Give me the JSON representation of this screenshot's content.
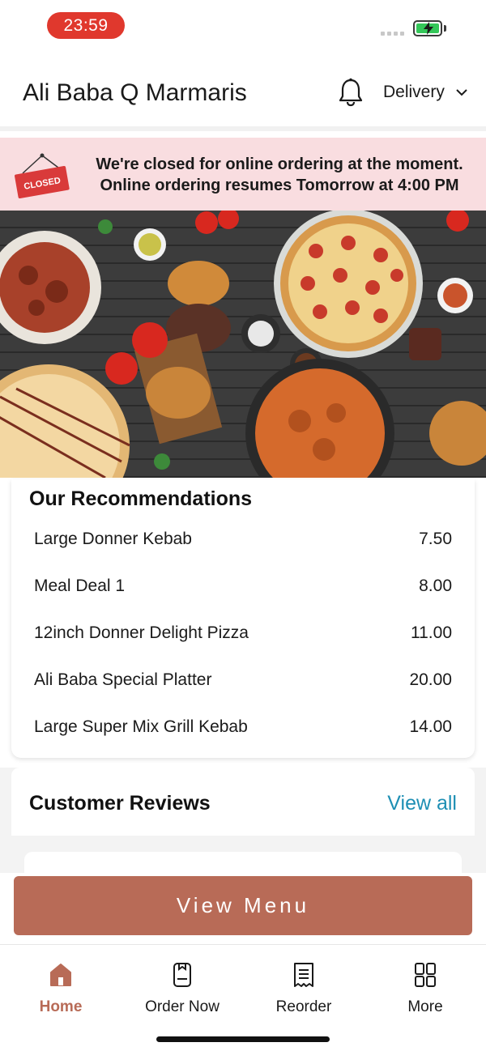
{
  "status_bar": {
    "time": "23:59"
  },
  "header": {
    "store_name": "Ali Baba Q Marmaris",
    "delivery_label": "Delivery"
  },
  "closed_banner": {
    "sign_text": "CLOSED",
    "line1": "We're closed for online ordering at the moment.",
    "line2": "Online ordering resumes Tomorrow at 4:00 PM"
  },
  "recommendations": {
    "title": "Our Recommendations",
    "items": [
      {
        "name": "Large Donner Kebab",
        "price": "7.50"
      },
      {
        "name": "Meal Deal 1",
        "price": "8.00"
      },
      {
        "name": "12inch Donner Delight Pizza",
        "price": "11.00"
      },
      {
        "name": "Ali Baba Special Platter",
        "price": "20.00"
      },
      {
        "name": "Large Super Mix Grill Kebab",
        "price": "14.00"
      }
    ]
  },
  "reviews": {
    "title": "Customer Reviews",
    "view_all": "View all"
  },
  "view_menu_button": "View Menu",
  "tab_bar": {
    "tabs": [
      {
        "label": "Home",
        "icon": "home-icon",
        "active": true
      },
      {
        "label": "Order Now",
        "icon": "order-icon",
        "active": false
      },
      {
        "label": "Reorder",
        "icon": "receipt-icon",
        "active": false
      },
      {
        "label": "More",
        "icon": "grid-icon",
        "active": false
      }
    ]
  },
  "colors": {
    "accent": "#b86b57",
    "link": "#1e8fb4",
    "banner_bg": "#f9dde0",
    "time_pill": "#e0382d",
    "battery": "#34c759"
  }
}
